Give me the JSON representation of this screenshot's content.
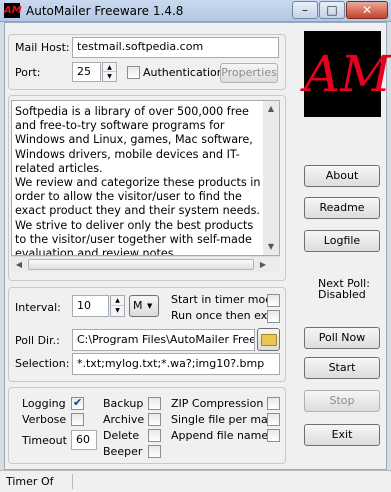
{
  "window": {
    "title": "AutoMailer Freeware 1.4.8",
    "logo_text": "AM",
    "minimize": "–",
    "maximize": "□",
    "close": "✕"
  },
  "mail": {
    "host_label": "Mail Host:",
    "host_value": "testmail.softpedia.com",
    "port_label": "Port:",
    "port_value": "25",
    "auth_label": "Authentication",
    "auth_checked": false,
    "properties_label": "Properties"
  },
  "description": "Softpedia is a library of over 500,000 free and free-to-try software programs for Windows and Linux, games, Mac software, Windows drivers, mobile devices and IT-related articles.\nWe review and categorize these products in order to allow the visitor/user to find the exact product they and their system needs.\nWe strive to deliver only the best products to the visitor/user together with self-made evaluation and review notes.",
  "side_buttons": {
    "about": "About",
    "readme": "Readme",
    "logfile": "Logfile"
  },
  "next_poll": {
    "label": "Next Poll:",
    "value": "Disabled"
  },
  "poll": {
    "interval_label": "Interval:",
    "interval_value": "10",
    "unit_value": "M",
    "start_timer_label": "Start in timer mode",
    "run_once_label": "Run once then exit",
    "dir_label": "Poll Dir.:",
    "dir_value": "C:\\Program Files\\AutoMailer Freeware",
    "selection_label": "Selection:",
    "selection_value": "*.txt;mylog.txt;*.wa?;img10?.bmp"
  },
  "actions": {
    "poll_now": "Poll Now",
    "start": "Start",
    "stop": "Stop",
    "exit": "Exit"
  },
  "options": {
    "logging": "Logging",
    "verbose": "Verbose",
    "timeout_label": "Timeout",
    "timeout_value": "60",
    "backup": "Backup",
    "archive": "Archive",
    "delete": "Delete",
    "beeper": "Beeper",
    "zip": "ZIP Compression",
    "single_file": "Single file per mail",
    "append_names": "Append file names"
  },
  "status": "Timer Of",
  "colors": {
    "logo_bg": "#000000",
    "logo_fg": "#e8001e"
  }
}
